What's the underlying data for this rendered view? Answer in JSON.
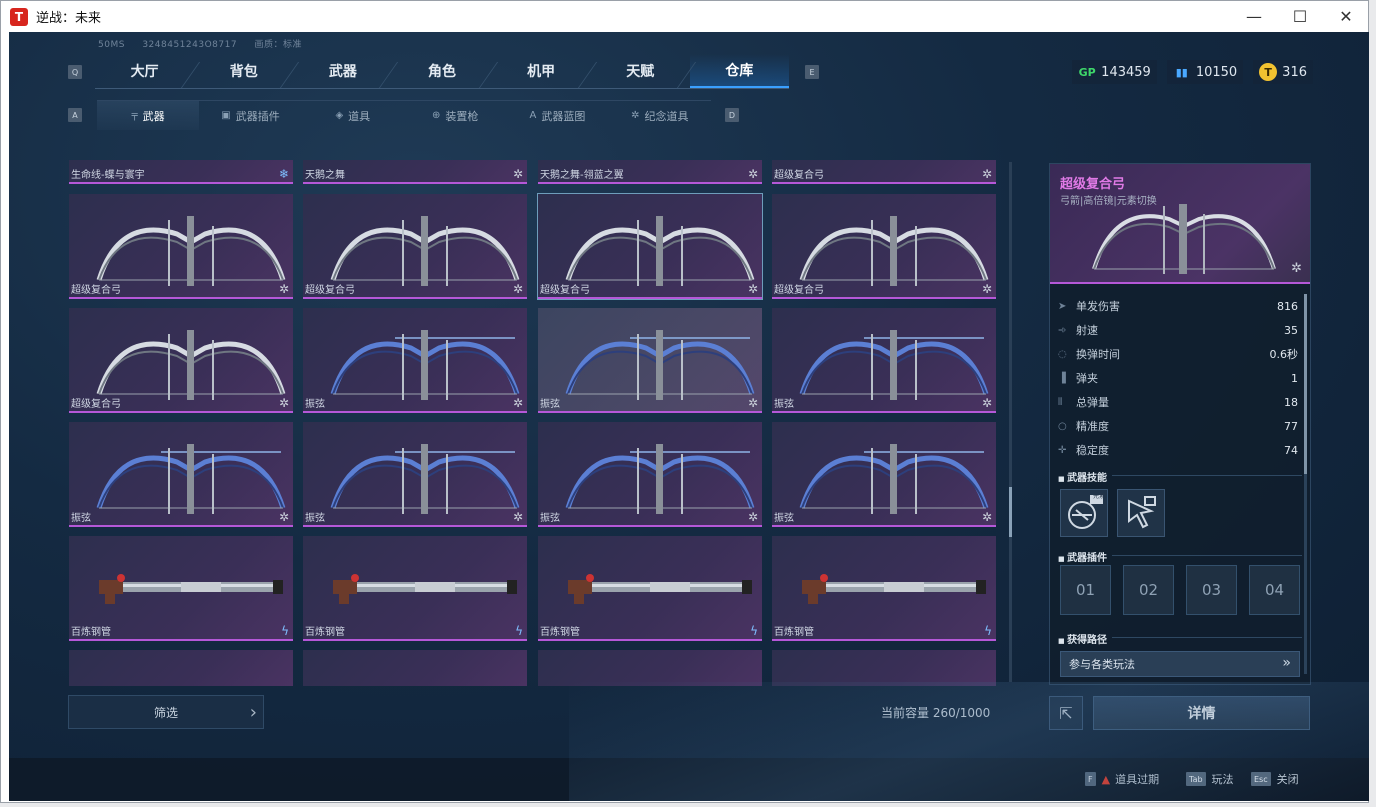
{
  "window": {
    "title": "逆战：未来",
    "icon_letter": "T",
    "minimize": "—",
    "maximize": "☐",
    "close": "✕"
  },
  "sysinfo": {
    "ms": "50MS",
    "id": "3248451243O8717",
    "quality": "画质：标准"
  },
  "keys": {
    "prev_main": "Q",
    "next_main": "E",
    "prev_sub": "A",
    "next_sub": "D"
  },
  "main_tabs": [
    "大厅",
    "背包",
    "武器",
    "角色",
    "机甲",
    "天赋",
    "仓库"
  ],
  "main_tab_active": "仓库",
  "currencies": [
    {
      "icon": "GP",
      "value": "143459",
      "color": "#3ed76a"
    },
    {
      "icon": "▮▮",
      "value": "10150",
      "color": "#4aa8ff"
    },
    {
      "icon": "T",
      "value": "316",
      "color": "#f2c230"
    }
  ],
  "sub_tabs": [
    {
      "label": "武器",
      "icon": "gun-icon",
      "glyph": "╤"
    },
    {
      "label": "武器插件",
      "icon": "plugin-icon",
      "glyph": "▣"
    },
    {
      "label": "道具",
      "icon": "item-icon",
      "glyph": "◈"
    },
    {
      "label": "装置枪",
      "icon": "device-gun-icon",
      "glyph": "⊕"
    },
    {
      "label": "武器蓝图",
      "icon": "blueprint-icon",
      "glyph": "A"
    },
    {
      "label": "纪念道具",
      "icon": "souvenir-icon",
      "glyph": "✲"
    }
  ],
  "sub_tab_active": "武器",
  "grid_top_row": [
    {
      "name": "生命线-蝶与寰宇",
      "badge": "❄",
      "badge_type": "blue"
    },
    {
      "name": "天鹅之舞",
      "badge": "✲",
      "badge_type": "white"
    },
    {
      "name": "天鹅之舞-翎蓝之翼",
      "badge": "✲",
      "badge_type": "white"
    },
    {
      "name": "超级复合弓",
      "badge": "✲",
      "badge_type": "white"
    }
  ],
  "grid_rows": [
    [
      {
        "name": "超级复合弓",
        "art": "bow",
        "badge": "✲"
      },
      {
        "name": "超级复合弓",
        "art": "bow",
        "badge": "✲"
      },
      {
        "name": "超级复合弓",
        "art": "bow",
        "badge": "✲"
      },
      {
        "name": "超级复合弓",
        "art": "bow",
        "badge": "✲"
      }
    ],
    [
      {
        "name": "超级复合弓",
        "art": "bow",
        "badge": "✲"
      },
      {
        "name": "振弦",
        "art": "bluebow",
        "badge": "✲"
      },
      {
        "name": "振弦",
        "art": "bluebow",
        "badge": "✲"
      },
      {
        "name": "振弦",
        "art": "bluebow",
        "badge": "✲"
      }
    ],
    [
      {
        "name": "振弦",
        "art": "bluebow",
        "badge": "✲"
      },
      {
        "name": "振弦",
        "art": "bluebow",
        "badge": "✲"
      },
      {
        "name": "振弦",
        "art": "bluebow",
        "badge": "✲"
      },
      {
        "name": "振弦",
        "art": "bluebow",
        "badge": "✲"
      }
    ],
    [
      {
        "name": "百炼钢管",
        "art": "pipe",
        "badge": "ϟ"
      },
      {
        "name": "百炼钢管",
        "art": "pipe",
        "badge": "ϟ"
      },
      {
        "name": "百炼钢管",
        "art": "pipe",
        "badge": "ϟ"
      },
      {
        "name": "百炼钢管",
        "art": "pipe",
        "badge": "ϟ"
      }
    ]
  ],
  "filter_label": "筛选",
  "capacity_text": "当前容量 260/1000",
  "detail": {
    "name": "超级复合弓",
    "tags": "弓箭|高倍镜|元素切换",
    "badge": "✲",
    "stats": [
      {
        "label": "单发伤害",
        "value": "816",
        "icon": "➤"
      },
      {
        "label": "射速",
        "value": "35",
        "icon": "➾"
      },
      {
        "label": "换弹时间",
        "value": "0.6秒",
        "icon": "◌"
      },
      {
        "label": "弹夹",
        "value": "1",
        "icon": "▐"
      },
      {
        "label": "总弹量",
        "value": "18",
        "icon": "⫴"
      },
      {
        "label": "精准度",
        "value": "77",
        "icon": "○"
      },
      {
        "label": "稳定度",
        "value": "74",
        "icon": "✛"
      }
    ],
    "skills_title": "武器技能",
    "skill_tag": "元素",
    "plugins_title": "武器插件",
    "plugin_slots": [
      "01",
      "02",
      "03",
      "04"
    ],
    "source_title": "获得路径",
    "source_button": "参与各类玩法"
  },
  "share_glyph": "⇱",
  "detail_button": "详情",
  "footer": [
    {
      "key": "F",
      "label": "道具过期",
      "warn": "▲"
    },
    {
      "key": "Tab",
      "label": "玩法",
      "warn": ""
    },
    {
      "key": "Esc",
      "label": "关闭",
      "warn": ""
    }
  ]
}
